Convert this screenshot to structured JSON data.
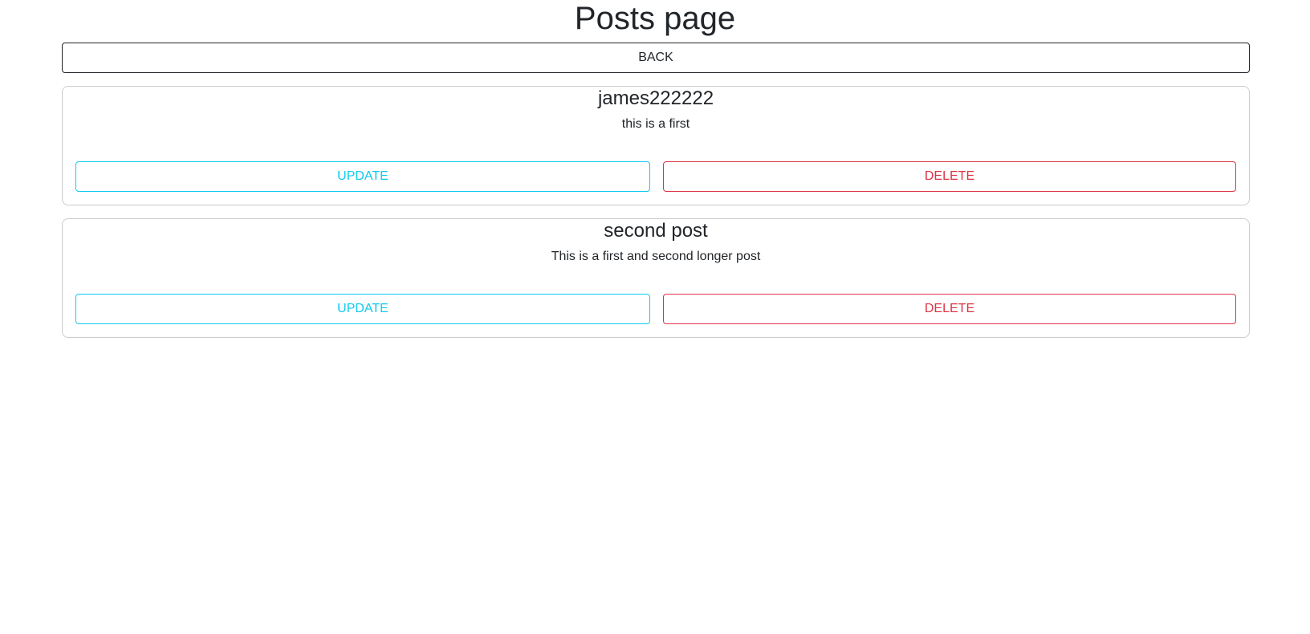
{
  "page": {
    "title": "Posts page"
  },
  "nav": {
    "back_label": "BACK"
  },
  "posts": [
    {
      "title": "james222222",
      "body": "this is a first",
      "update_label": "UPDATE",
      "delete_label": "DELETE"
    },
    {
      "title": "second post",
      "body": "This is a first and second longer post",
      "update_label": "UPDATE",
      "delete_label": "DELETE"
    }
  ],
  "colors": {
    "text": "#212529",
    "update": "#0dcaf0",
    "delete": "#dc3545",
    "card_border": "#cccccc"
  }
}
